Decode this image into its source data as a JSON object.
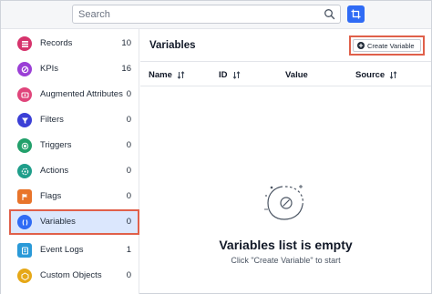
{
  "search": {
    "placeholder": "Search"
  },
  "sidebar": {
    "items": [
      {
        "label": "Records",
        "count": "10",
        "icon": "records-icon",
        "color": "#d6336c"
      },
      {
        "label": "KPIs",
        "count": "16",
        "icon": "kpi-icon",
        "color": "#9b3fd6"
      },
      {
        "label": "Augmented Attributes",
        "count": "0",
        "icon": "augmented-attributes-icon",
        "color": "#e0457b"
      },
      {
        "label": "Filters",
        "count": "0",
        "icon": "filter-icon",
        "color": "#3b3fd6"
      },
      {
        "label": "Triggers",
        "count": "0",
        "icon": "trigger-icon",
        "color": "#22a06b"
      },
      {
        "label": "Actions",
        "count": "0",
        "icon": "actions-icon",
        "color": "#1f9e8a"
      },
      {
        "label": "Flags",
        "count": "0",
        "icon": "flag-icon",
        "color": "#e8742a"
      },
      {
        "label": "Variables",
        "count": "0",
        "icon": "variables-icon",
        "color": "#2f6bf5"
      },
      {
        "label": "Event Logs",
        "count": "1",
        "icon": "event-logs-icon",
        "color": "#2a9ad8"
      },
      {
        "label": "Custom Objects",
        "count": "0",
        "icon": "custom-objects-icon",
        "color": "#e6a817"
      }
    ]
  },
  "main": {
    "title": "Variables",
    "create_label": "Create Variable",
    "columns": [
      "Name",
      "ID",
      "Value",
      "Source"
    ],
    "empty_title": "Variables list is empty",
    "empty_subtitle": "Click \"Create Variable\" to start"
  },
  "colors": {
    "accent": "#2f6bf5",
    "highlight": "#e0604a",
    "active_bg": "#dbe7fd"
  }
}
